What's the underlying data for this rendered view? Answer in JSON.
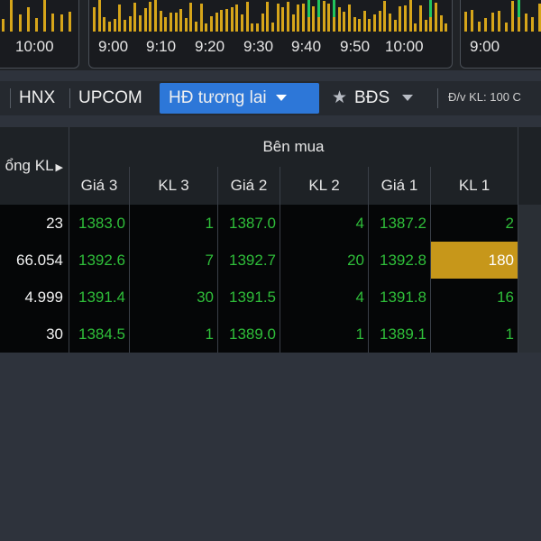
{
  "charts": {
    "left_label": "10:00",
    "main_labels": [
      "9:00",
      "9:10",
      "9:20",
      "9:30",
      "9:40",
      "9:50",
      "10:00"
    ],
    "right_label": "9:00",
    "bar_color": "#d6a51a",
    "spark_color": "#22c55e"
  },
  "tabs": {
    "items": [
      "HNX",
      "UPCOM",
      "HĐ tương lai",
      "BĐS"
    ],
    "active": "HĐ tương lai",
    "unit": "Đ/v KL: 100 C",
    "accent": "#2d77d8"
  },
  "table": {
    "tong_kl_label": "ổng KL",
    "group_title": "Bên mua",
    "columns": [
      "Giá 3",
      "KL 3",
      "Giá 2",
      "KL 2",
      "Giá 1",
      "KL 1"
    ],
    "rows": [
      {
        "total": "23",
        "cells": [
          "1383.0",
          "1",
          "1387.0",
          "4",
          "1387.2",
          "2"
        ]
      },
      {
        "total": "66.054",
        "cells": [
          "1392.6",
          "7",
          "1392.7",
          "20",
          "1392.8",
          "180"
        ]
      },
      {
        "total": "4.999",
        "cells": [
          "1391.4",
          "30",
          "1391.5",
          "4",
          "1391.8",
          "16"
        ]
      },
      {
        "total": "30",
        "cells": [
          "1384.5",
          "1",
          "1389.0",
          "1",
          "1389.1",
          "1"
        ]
      }
    ],
    "highlight_color": "#c7971a",
    "price_color": "#2fbf3a"
  }
}
